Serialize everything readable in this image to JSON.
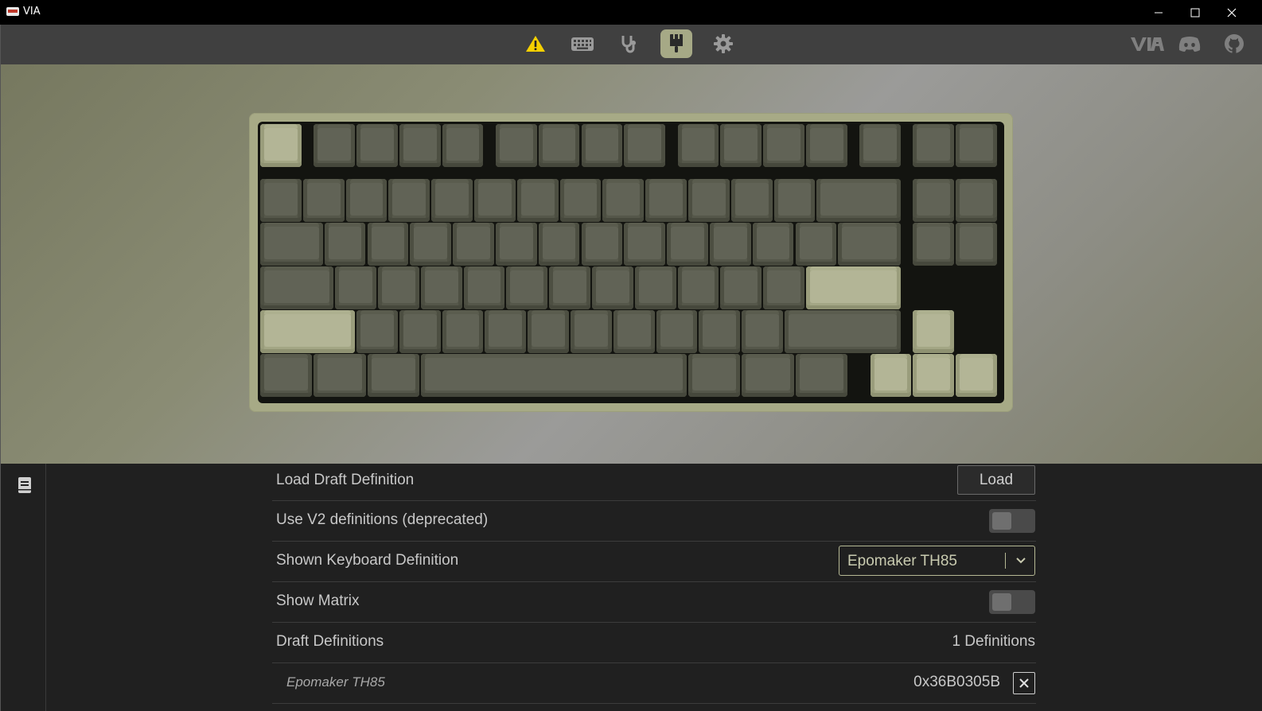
{
  "window": {
    "title": "VIA"
  },
  "nav": {
    "items": [
      {
        "name": "warning-icon",
        "active": false
      },
      {
        "name": "keyboard-icon",
        "active": false
      },
      {
        "name": "stethoscope-icon",
        "active": false
      },
      {
        "name": "brush-icon",
        "active": true
      },
      {
        "name": "gear-icon",
        "active": false
      }
    ],
    "right_links": [
      "via-logo-icon",
      "discord-icon",
      "github-icon"
    ],
    "accent": "#a6a986"
  },
  "keyboard": {
    "alt_keycap_color": "#a3a685",
    "base_keycap_color": "#55574a",
    "case_color": "#a7aa86"
  },
  "settings": {
    "load_draft": {
      "label": "Load Draft Definition",
      "button": "Load"
    },
    "use_v2": {
      "label": "Use V2 definitions (deprecated)",
      "enabled": false
    },
    "shown_definition": {
      "label": "Shown Keyboard Definition",
      "value": "Epomaker TH85"
    },
    "show_matrix": {
      "label": "Show Matrix",
      "enabled": false
    },
    "draft_definitions": {
      "label": "Draft Definitions",
      "count_text": "1 Definitions",
      "items": [
        {
          "name": "Epomaker TH85",
          "id": "0x36B0305B"
        }
      ]
    }
  }
}
